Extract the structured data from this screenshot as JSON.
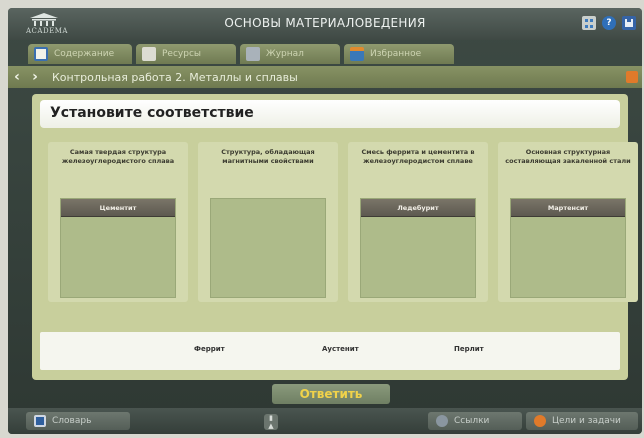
{
  "app": {
    "title": "ОСНОВЫ МАТЕРИАЛОВЕДЕНИЯ",
    "logo_text": "ACADEMA",
    "top_icons": [
      "grid-icon",
      "help-icon",
      "save-icon"
    ]
  },
  "tabs": [
    {
      "label": "Содержание",
      "icon": "contents-icon"
    },
    {
      "label": "Ресурсы",
      "icon": "resources-icon"
    },
    {
      "label": "Журнал",
      "icon": "journal-icon"
    },
    {
      "label": "Избранное",
      "icon": "favorites-icon"
    }
  ],
  "breadcrumb": "Контрольная работа 2. Металлы и сплавы",
  "task": {
    "heading": "Установите соответствие",
    "columns": [
      {
        "caption": "Самая твердая структура железоуглеродистого сплава",
        "placed": "Цементит"
      },
      {
        "caption": "Структура, обладающая магнитными свойствами",
        "placed": ""
      },
      {
        "caption": "Смесь феррита и цементита в железоуглеродистом сплаве",
        "placed": "Ледебурит"
      },
      {
        "caption": "Основная структурная составляющая закаленной стали",
        "placed": "Мартенсит"
      }
    ],
    "options": [
      "Феррит",
      "Аустенит",
      "Перлит"
    ]
  },
  "answer_button": "Ответить",
  "bottom": {
    "dictionary": "Словарь",
    "links": "Ссылки",
    "goals": "Цели и задачи",
    "colors": {
      "accent": "#f0d24a",
      "orange": "#e07a2a"
    }
  }
}
